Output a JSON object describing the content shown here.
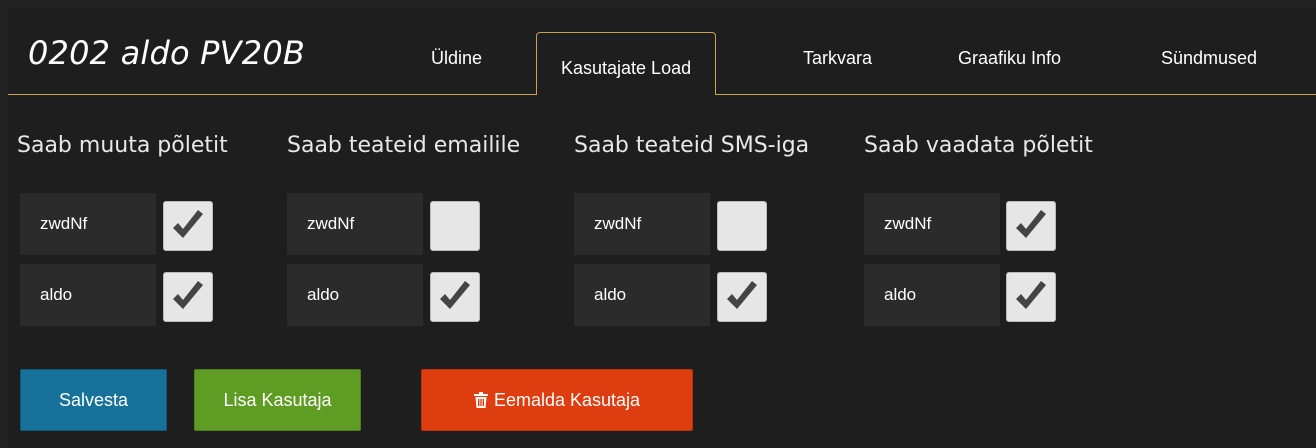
{
  "header": {
    "title": "0202 aldo PV20B",
    "tabs": [
      {
        "label": "Üldine",
        "active": false
      },
      {
        "label": "Kasutajate Load",
        "active": true
      },
      {
        "label": "Tarkvara",
        "active": false
      },
      {
        "label": "Graafiku Info",
        "active": false
      },
      {
        "label": "Sündmused",
        "active": false
      }
    ]
  },
  "columns": [
    {
      "header": "Saab muuta põletit",
      "rows": [
        {
          "user": "zwdNf",
          "checked": true
        },
        {
          "user": "aldo",
          "checked": true
        }
      ]
    },
    {
      "header": "Saab teateid emailile",
      "rows": [
        {
          "user": "zwdNf",
          "checked": false
        },
        {
          "user": "aldo",
          "checked": true
        }
      ]
    },
    {
      "header": "Saab teateid SMS-iga",
      "rows": [
        {
          "user": "zwdNf",
          "checked": false
        },
        {
          "user": "aldo",
          "checked": true
        }
      ]
    },
    {
      "header": "Saab vaadata põletit",
      "rows": [
        {
          "user": "zwdNf",
          "checked": true
        },
        {
          "user": "aldo",
          "checked": true
        }
      ]
    }
  ],
  "actions": {
    "save_label": "Salvesta",
    "add_label": "Lisa Kasutaja",
    "remove_label": "Eemalda Kasutaja",
    "remove_icon": "trash-icon"
  },
  "colors": {
    "accent_border": "#c8a24a",
    "save": "#17729b",
    "add": "#5f9c23",
    "remove": "#de3d0f"
  }
}
